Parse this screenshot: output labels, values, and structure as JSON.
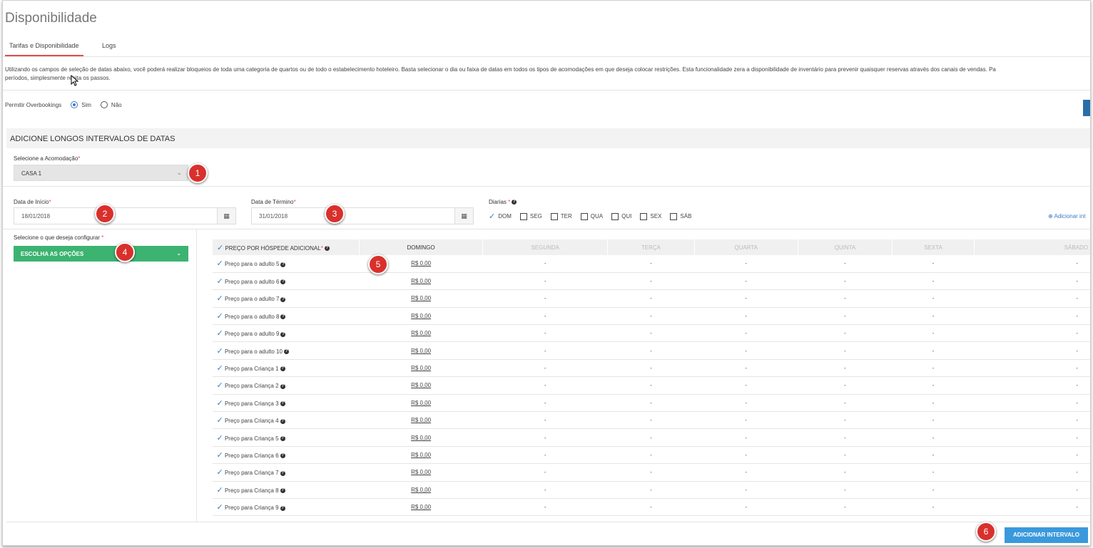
{
  "page": {
    "title": "Disponibilidade"
  },
  "tabs": [
    {
      "label": "Tarifas e Disponibilidade"
    },
    {
      "label": "Logs"
    }
  ],
  "description": {
    "line1": "Utilizando os campos de seleção de datas abaixo, você poderá realizar bloqueios de toda uma categoria de quartos ou de todo o estabelecimento hoteleiro. Basta selecionar o dia ou faixa de datas em todos os tipos de acomodações em que deseja colocar restrições. Esta funcionalidade zera a disponibilidade de inventário para prevenir quaisquer reservas através dos canais de vendas. Pa",
    "line2": "períodos, simplesmente repita os passos."
  },
  "overbooking": {
    "label": "Permitir Overbookings",
    "options": [
      {
        "label": "Sim",
        "selected": true
      },
      {
        "label": "Não",
        "selected": false
      }
    ]
  },
  "section": {
    "title": "ADICIONE LONGOS INTERVALOS DE DATAS"
  },
  "accommodation": {
    "label": "Selecione a Acomodação",
    "value": "CASA 1"
  },
  "start_date": {
    "label": "Data de Início",
    "value": "18/01/2018"
  },
  "end_date": {
    "label": "Data de Término",
    "value": "31/01/2018"
  },
  "diarias": {
    "label": "Diarias",
    "days": [
      {
        "label": "DOM",
        "checked": true
      },
      {
        "label": "SEG",
        "checked": false
      },
      {
        "label": "TER",
        "checked": false
      },
      {
        "label": "QUA",
        "checked": false
      },
      {
        "label": "QUI",
        "checked": false
      },
      {
        "label": "SEX",
        "checked": false
      },
      {
        "label": "SÁB",
        "checked": false
      }
    ]
  },
  "add_interval_link": "Adicionar int",
  "configure": {
    "label": "Selecione o que deseja configurar",
    "button": "ESCOLHA AS OPÇÕES"
  },
  "table": {
    "header_first": "PREÇO POR HÓSPEDE ADICIONAL",
    "columns": [
      "DOMINGO",
      "SEGUNDA",
      "TERÇA",
      "QUARTA",
      "QUINTA",
      "SEXTA",
      "SÁBADO"
    ],
    "rows": [
      {
        "label": "Preço para o adulto 5",
        "price": "R$ 0,00"
      },
      {
        "label": "Preço para o adulto 6",
        "price": "R$ 0,00"
      },
      {
        "label": "Preço para o adulto 7",
        "price": "R$ 0,00"
      },
      {
        "label": "Preço para o adulto 8",
        "price": "R$ 0,00"
      },
      {
        "label": "Preço para o adulto 9",
        "price": "R$ 0,00"
      },
      {
        "label": "Preço para o adulto 10",
        "price": "R$ 0,00"
      },
      {
        "label": "Preço para Criança 1",
        "price": "R$ 0,00"
      },
      {
        "label": "Preço para Criança 2",
        "price": "R$ 0,00"
      },
      {
        "label": "Preço para Criança 3",
        "price": "R$ 0,00"
      },
      {
        "label": "Preço para Criança 4",
        "price": "R$ 0,00"
      },
      {
        "label": "Preço para Criança 5",
        "price": "R$ 0,00"
      },
      {
        "label": "Preço para Criança 6",
        "price": "R$ 0,00"
      },
      {
        "label": "Preço para Criança 7",
        "price": "R$ 0,00"
      },
      {
        "label": "Preço para Criança 8",
        "price": "R$ 0,00"
      },
      {
        "label": "Preço para Criança 9",
        "price": "R$ 0,00"
      }
    ],
    "empty": "-"
  },
  "submit": {
    "label": "ADICIONAR INTERVALO"
  },
  "markers": [
    "1",
    "2",
    "3",
    "4",
    "5",
    "6"
  ],
  "colors": {
    "accent_red": "#e34c4c",
    "green": "#3cb371",
    "blue": "#3a99dc",
    "marker": "#d9302c"
  }
}
